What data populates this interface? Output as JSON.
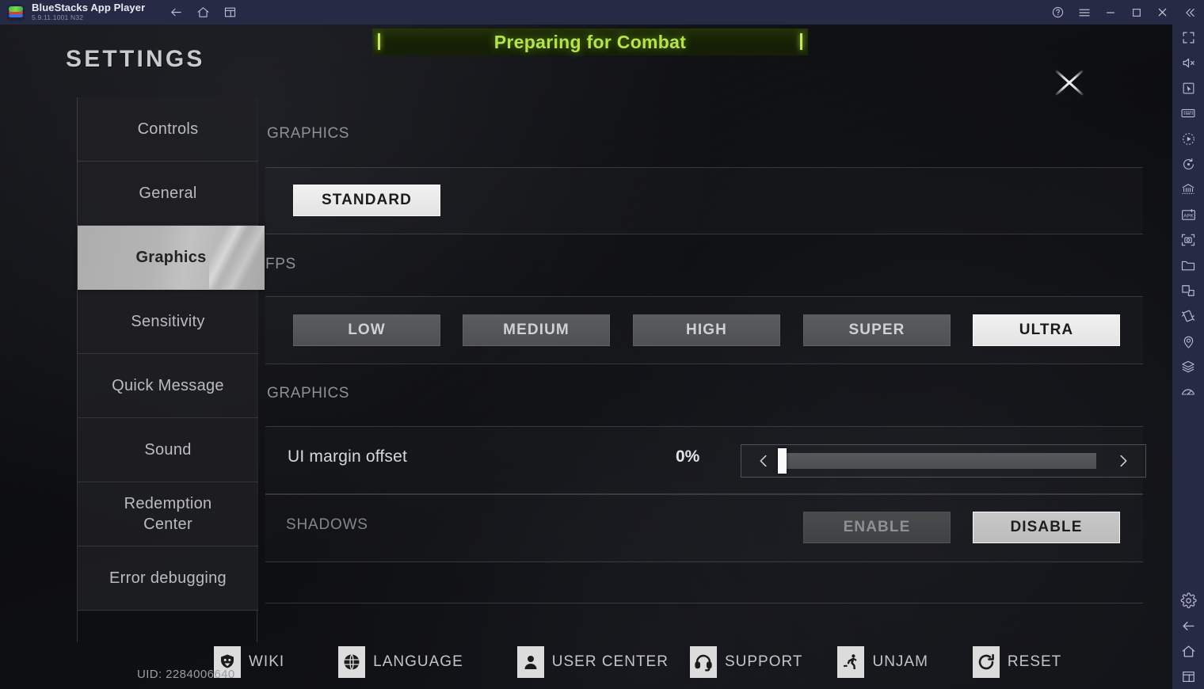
{
  "bluestacks": {
    "app_name": "BlueStacks App Player",
    "version": "5.9.11.1001  N32",
    "logo_icon": "bluestacks-logo",
    "nav": [
      {
        "name": "back-icon",
        "label": "Back"
      },
      {
        "name": "home-icon",
        "label": "Home"
      },
      {
        "name": "multi-instance-icon",
        "label": "Instance Manager"
      }
    ],
    "window_controls": [
      {
        "name": "help-icon",
        "label": "Help"
      },
      {
        "name": "menu-icon",
        "label": "Menu"
      },
      {
        "name": "minimize-icon",
        "label": "Minimize"
      },
      {
        "name": "maximize-icon",
        "label": "Maximize"
      },
      {
        "name": "close-icon",
        "label": "Close"
      },
      {
        "name": "collapse-sidebar-icon",
        "label": "Collapse"
      }
    ],
    "sidebar_tools": [
      {
        "name": "fullscreen-icon",
        "label": "Full screen"
      },
      {
        "name": "mute-icon",
        "label": "Mute"
      },
      {
        "name": "cursor-icon",
        "label": "Game controls"
      },
      {
        "name": "keyboard-icon",
        "label": "Keymapping"
      },
      {
        "name": "macro-record-icon",
        "label": "Macro recorder"
      },
      {
        "name": "rotate-icon",
        "label": "Rotate"
      },
      {
        "name": "multi-instance-sync-icon",
        "label": "Multi-instance sync"
      },
      {
        "name": "install-apk-icon",
        "label": "Install APK"
      },
      {
        "name": "screenshot-icon",
        "label": "Screenshot"
      },
      {
        "name": "media-folder-icon",
        "label": "Media manager"
      },
      {
        "name": "pip-icon",
        "label": "Picture in picture"
      },
      {
        "name": "shake-icon",
        "label": "Shake"
      },
      {
        "name": "location-icon",
        "label": "Location"
      },
      {
        "name": "layers-icon",
        "label": "Eco mode"
      },
      {
        "name": "performance-icon",
        "label": "Performance"
      }
    ],
    "sidebar_bottom": [
      {
        "name": "settings-gear-icon",
        "label": "Settings"
      },
      {
        "name": "back-arrow-icon",
        "label": "Back"
      },
      {
        "name": "home-house-icon",
        "label": "Home"
      },
      {
        "name": "recents-icon",
        "label": "Recent apps"
      }
    ]
  },
  "game": {
    "banner_text": "Preparing for Combat",
    "page_title": "SETTINGS",
    "close_icon": "close-x-icon",
    "uid": "UID: 2284006640",
    "tabs": [
      {
        "label": "Controls",
        "active": false
      },
      {
        "label": "General",
        "active": false
      },
      {
        "label": "Graphics",
        "active": true
      },
      {
        "label": "Sensitivity",
        "active": false
      },
      {
        "label": "Quick Message",
        "active": false
      },
      {
        "label": "Sound",
        "active": false
      },
      {
        "label": "Redemption Center",
        "active": false
      },
      {
        "label": "Error debugging",
        "active": false
      }
    ],
    "sections": {
      "graphics_quality": {
        "heading": "GRAPHICS",
        "options": [
          {
            "label": "STANDARD",
            "selected": true
          }
        ]
      },
      "fps": {
        "heading": "FPS",
        "options": [
          {
            "label": "LOW",
            "selected": false
          },
          {
            "label": "MEDIUM",
            "selected": false
          },
          {
            "label": "HIGH",
            "selected": false
          },
          {
            "label": "SUPER",
            "selected": false
          },
          {
            "label": "ULTRA",
            "selected": true
          }
        ]
      },
      "graphics_extra": {
        "heading": "GRAPHICS",
        "ui_margin": {
          "label": "UI margin offset",
          "value_text": "0%",
          "value": 0,
          "min": 0,
          "max": 100,
          "left_arrow_icon": "chevron-left-icon",
          "right_arrow_icon": "chevron-right-icon"
        },
        "shadows": {
          "label": "SHADOWS",
          "options": [
            {
              "label": "ENABLE",
              "selected": false
            },
            {
              "label": "DISABLE",
              "selected": true
            }
          ]
        }
      }
    },
    "bottom_bar": [
      {
        "label": "WIKI",
        "icon": "wiki-crest-icon"
      },
      {
        "label": "LANGUAGE",
        "icon": "globe-icon"
      },
      {
        "label": "USER CENTER",
        "icon": "user-icon"
      },
      {
        "label": "SUPPORT",
        "icon": "headset-icon"
      },
      {
        "label": "UNJAM",
        "icon": "runner-icon"
      },
      {
        "label": "RESET",
        "icon": "reset-refresh-icon"
      }
    ]
  },
  "colors": {
    "titlebar_bg": "#262a45",
    "banner_green": "#b6e34a",
    "selected_button": "#f1f1f1",
    "panel_text": "#c3c5c8"
  }
}
